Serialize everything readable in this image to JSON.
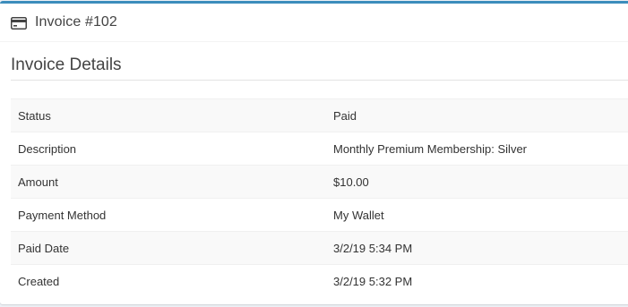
{
  "header": {
    "icon": "credit-card-icon",
    "title": "Invoice #102"
  },
  "details": {
    "section_title": "Invoice Details",
    "rows": [
      {
        "label": "Status",
        "value": "Paid"
      },
      {
        "label": "Description",
        "value": "Monthly Premium Membership: Silver"
      },
      {
        "label": "Amount",
        "value": "$10.00"
      },
      {
        "label": "Payment Method",
        "value": "My Wallet"
      },
      {
        "label": "Paid Date",
        "value": "3/2/19 5:34 PM"
      },
      {
        "label": "Created",
        "value": "3/2/19 5:32 PM"
      }
    ]
  },
  "colors": {
    "accent": "#3c8dbc",
    "stripe": "#f9f9f9",
    "text": "#333333"
  }
}
